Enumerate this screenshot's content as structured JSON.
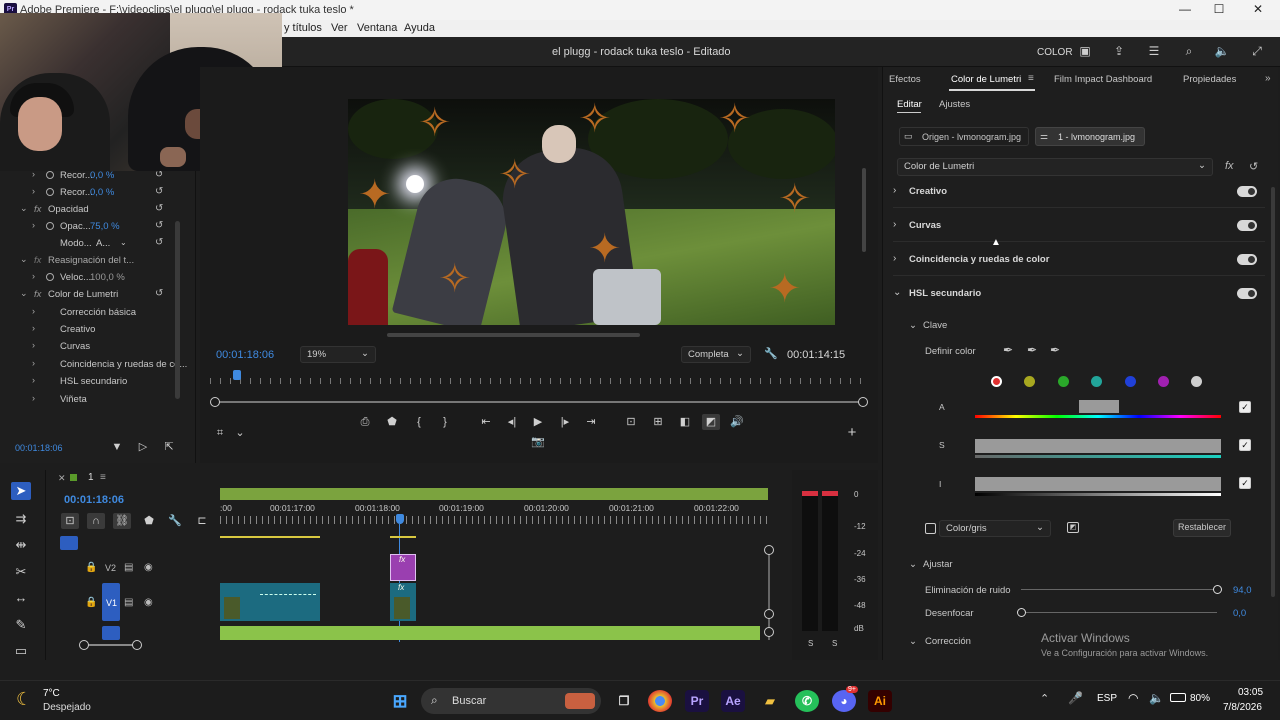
{
  "window": {
    "title": "Adobe Premiere - F:\\videoclips\\el plugg\\el plugg - rodack tuka teslo *",
    "minimize": "—",
    "maximize": "☐",
    "close": "✕"
  },
  "menu": {
    "items": [
      "y títulos",
      "Ver",
      "Ventana",
      "Ayuda"
    ]
  },
  "appbar": {
    "project_title": "el plugg - rodack tuka teslo - Editado",
    "workspace_label": "COLOR"
  },
  "effects_panel": {
    "rows": [
      {
        "label": "Recor...",
        "value": "0,0 %"
      },
      {
        "label": "Recor...",
        "value": "0,0 %"
      },
      {
        "label": "Opacidad",
        "value": ""
      },
      {
        "label": "Opac...",
        "value": "75,0 %"
      },
      {
        "label": "Modo...",
        "value": "A..."
      },
      {
        "label": "Reasignación del t...",
        "value": ""
      },
      {
        "label": "Veloc...",
        "value": "100,0 %"
      },
      {
        "label": "Color de Lumetri",
        "value": ""
      },
      {
        "label": "Corrección básica",
        "value": ""
      },
      {
        "label": "Creativo",
        "value": ""
      },
      {
        "label": "Curvas",
        "value": ""
      },
      {
        "label": "Coincidencia y ruedas de co...",
        "value": ""
      },
      {
        "label": "HSL secundario",
        "value": ""
      },
      {
        "label": "Viñeta",
        "value": ""
      }
    ],
    "timecode": "00:01:18:06"
  },
  "program_monitor": {
    "timecode_current": "00:01:18:06",
    "zoom": "19%",
    "quality": "Completa",
    "timecode_duration": "00:01:14:15"
  },
  "timeline": {
    "sequence_name": "1",
    "timecode": "00:01:18:06",
    "ruler_labels": [
      ":00",
      "00:01:17:00",
      "00:01:18:00",
      "00:01:19:00",
      "00:01:20:00",
      "00:01:21:00",
      "00:01:22:00"
    ],
    "tracks": [
      {
        "name": "V2"
      },
      {
        "name": "V1"
      }
    ]
  },
  "meter": {
    "scale": [
      "0",
      "-12",
      "-24",
      "-36",
      "-48",
      "dB"
    ],
    "channels": [
      "S",
      "S"
    ]
  },
  "lumetri": {
    "tabs": [
      "Efectos",
      "Color de Lumetri",
      "Film Impact Dashboard",
      "Propiedades"
    ],
    "subtabs": [
      "Editar",
      "Ajustes"
    ],
    "source_clip": "Origen - lvmonogram.jpg",
    "sequence_clip": "1 - lvmonogram.jpg",
    "effect_select": "Color de Lumetri",
    "sections": [
      "Creativo",
      "Curvas",
      "Coincidencia y ruedas de color",
      "HSL secundario"
    ],
    "clave_label": "Clave",
    "definir_color": "Definir color",
    "swatch_colors": [
      "#e03030",
      "#a8a820",
      "#2aa82a",
      "#22a59a",
      "#2040d8",
      "#a020b0",
      "#cfcfcf"
    ],
    "hsl_rows": [
      "A",
      "S",
      "I"
    ],
    "color_gris": "Color/gris",
    "restablecer": "Restablecer",
    "ajustar_label": "Ajustar",
    "eliminacion_label": "Eliminación de ruido",
    "eliminacion_value": "94,0",
    "desenfocar_label": "Desenfocar",
    "desenfocar_value": "0,0",
    "correccion_label": "Corrección"
  },
  "activation": {
    "title": "Activar Windows",
    "subtitle": "Ve a Configuración para activar Windows."
  },
  "taskbar": {
    "weather_temp": "7°C",
    "weather_desc": "Despejado",
    "search_placeholder": "Buscar",
    "language": "ESP",
    "battery": "80%",
    "time": "03:05",
    "date": "7/8/2026",
    "discord_badge": "9+"
  }
}
